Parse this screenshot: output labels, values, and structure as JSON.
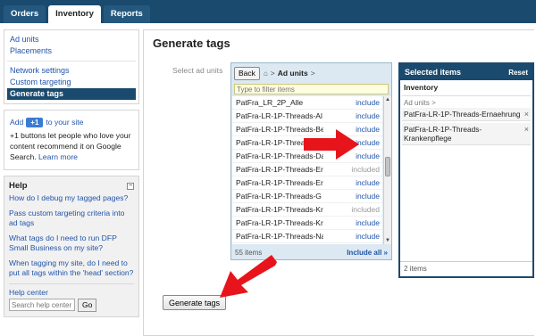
{
  "topnav": {
    "tabs": [
      {
        "label": "Orders"
      },
      {
        "label": "Inventory"
      },
      {
        "label": "Reports"
      }
    ]
  },
  "sidebar": {
    "group1": [
      "Ad units",
      "Placements"
    ],
    "group2": [
      "Network settings",
      "Custom targeting",
      "Generate tags"
    ],
    "plusone": {
      "add": "Add",
      "badge": "+1",
      "to_site": "to your site",
      "body": "+1 buttons let people who love your content recommend it on Google Search.",
      "learn_more": "Learn more"
    },
    "help": {
      "title": "Help",
      "links": [
        "How do I debug my tagged pages?",
        "Pass custom targeting criteria into ad tags",
        "What tags do I need to run DFP Small Business on my site?",
        "When tagging my site, do I need to put all tags within the 'head' section?"
      ],
      "help_center": "Help center",
      "search_placeholder": "Search help center",
      "go": "Go"
    }
  },
  "main": {
    "title": "Generate tags",
    "select_label": "Select ad units",
    "picker": {
      "back": "Back",
      "crumb": "Ad units",
      "filter_placeholder": "Type to filter items",
      "items": [
        {
          "name": "PatFra_LR_2P_Alle",
          "action": "include"
        },
        {
          "name": "PatFra-LR-1P-Threads-Al",
          "action": "include"
        },
        {
          "name": "PatFra-LR-1P-Threads-Be",
          "action": "include"
        },
        {
          "name": "PatFra-LR-1P-Threads-Co",
          "action": "include"
        },
        {
          "name": "PatFra-LR-1P-Threads-Da",
          "action": "include"
        },
        {
          "name": "PatFra-LR-1P-Threads-Er",
          "action": "included"
        },
        {
          "name": "PatFra-LR-1P-Threads-Er",
          "action": "include"
        },
        {
          "name": "PatFra-LR-1P-Threads-G",
          "action": "include"
        },
        {
          "name": "PatFra-LR-1P-Threads-Kr",
          "action": "included"
        },
        {
          "name": "PatFra-LR-1P-Threads-Kr",
          "action": "include"
        },
        {
          "name": "PatFra-LR-1P-Threads-Na",
          "action": "include"
        }
      ],
      "count": "55 items",
      "include_all": "Include all »"
    },
    "selected": {
      "title": "Selected items",
      "reset": "Reset",
      "group": "Inventory",
      "path": "Ad units >",
      "items": [
        "PatFra-LR-1P-Threads-Ernaehrung",
        "PatFra-LR-1P-Threads-Krankenpflege"
      ],
      "count": "2 items"
    },
    "generate_button": "Generate tags"
  },
  "colors": {
    "nav_bg": "#1a4a6e",
    "link": "#2255aa",
    "arrow": "#e8141b"
  }
}
